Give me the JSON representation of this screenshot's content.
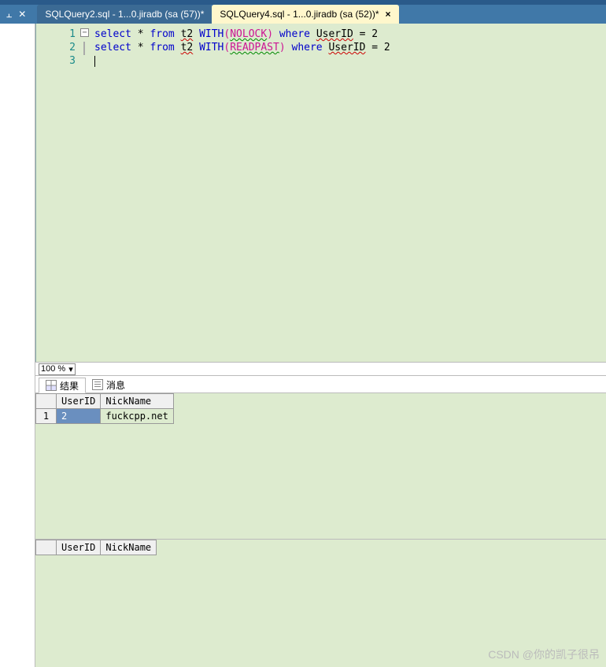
{
  "tabs": [
    {
      "label": "SQLQuery2.sql - 1...0.jiradb (sa (57))*",
      "active": false
    },
    {
      "label": "SQLQuery4.sql - 1...0.jiradb (sa (52))*",
      "active": true
    }
  ],
  "editor": {
    "line_numbers": [
      "1",
      "2",
      "3"
    ],
    "lines": [
      [
        {
          "t": "select",
          "c": "kw"
        },
        {
          "t": " * ",
          "c": "plain"
        },
        {
          "t": "from",
          "c": "kw"
        },
        {
          "t": " ",
          "c": "plain"
        },
        {
          "t": "t2",
          "c": "plain squiggle"
        },
        {
          "t": " ",
          "c": "plain"
        },
        {
          "t": "WITH",
          "c": "kw"
        },
        {
          "t": "(",
          "c": "func"
        },
        {
          "t": "NOLOCK",
          "c": "func squiggle-g"
        },
        {
          "t": ")",
          "c": "func"
        },
        {
          "t": " ",
          "c": "plain"
        },
        {
          "t": "where",
          "c": "kw"
        },
        {
          "t": " ",
          "c": "plain"
        },
        {
          "t": "UserID",
          "c": "plain squiggle"
        },
        {
          "t": " = 2",
          "c": "plain"
        }
      ],
      [
        {
          "t": "select",
          "c": "kw"
        },
        {
          "t": " * ",
          "c": "plain"
        },
        {
          "t": "from",
          "c": "kw"
        },
        {
          "t": " ",
          "c": "plain"
        },
        {
          "t": "t2",
          "c": "plain squiggle"
        },
        {
          "t": " ",
          "c": "plain"
        },
        {
          "t": "WITH",
          "c": "kw"
        },
        {
          "t": "(",
          "c": "func"
        },
        {
          "t": "READPAST",
          "c": "func squiggle-g"
        },
        {
          "t": ")",
          "c": "func"
        },
        {
          "t": " ",
          "c": "plain"
        },
        {
          "t": "where",
          "c": "kw"
        },
        {
          "t": " ",
          "c": "plain"
        },
        {
          "t": "UserID",
          "c": "plain squiggle"
        },
        {
          "t": " = 2",
          "c": "plain"
        }
      ],
      []
    ]
  },
  "zoom": {
    "value": "100 %"
  },
  "result_tabs": {
    "results": "结果",
    "messages": "消息"
  },
  "grid1": {
    "corner": "",
    "columns": [
      "UserID",
      "NickName"
    ],
    "rows": [
      {
        "num": "1",
        "cells": [
          "2",
          "fuckcpp.net"
        ],
        "selected_col": 0
      }
    ]
  },
  "grid2": {
    "corner": "",
    "columns": [
      "UserID",
      "NickName"
    ],
    "rows": []
  },
  "watermark": "CSDN @你的凯子很吊"
}
